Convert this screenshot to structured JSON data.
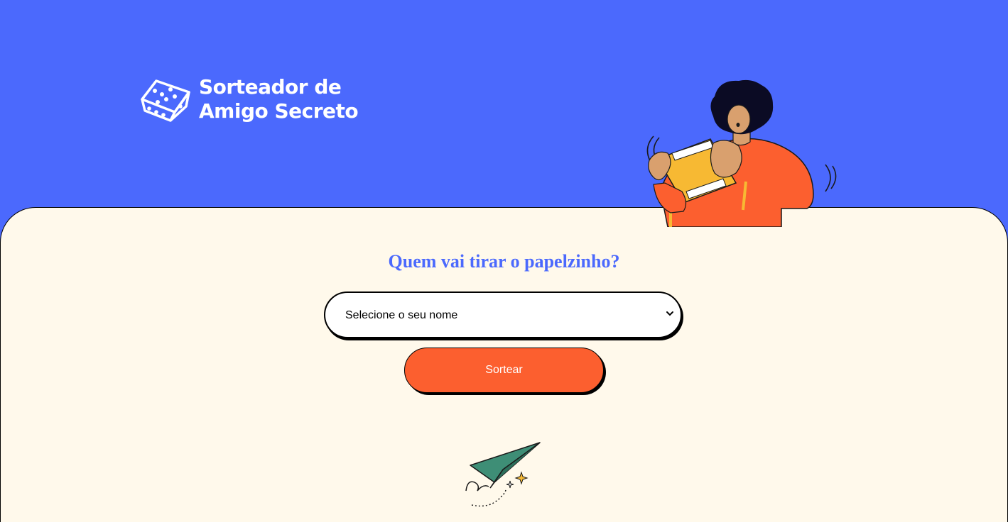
{
  "header": {
    "logo": {
      "line1": "Sorteador de",
      "line2": "Amigo Secreto",
      "icon": "dice-icon"
    },
    "illustration": "person-holding-gift-illustration"
  },
  "main": {
    "title": "Quem vai tirar o papelzinho?",
    "select": {
      "selected": "Selecione o seu nome",
      "icon": "chevron-down-icon"
    },
    "draw_button": "Sortear",
    "decoration": "paper-plane-illustration"
  },
  "colors": {
    "header_bg": "#4B69FD",
    "panel_bg": "#FFF9EB",
    "title": "#4B69FD",
    "button": "#FC5F2F"
  }
}
